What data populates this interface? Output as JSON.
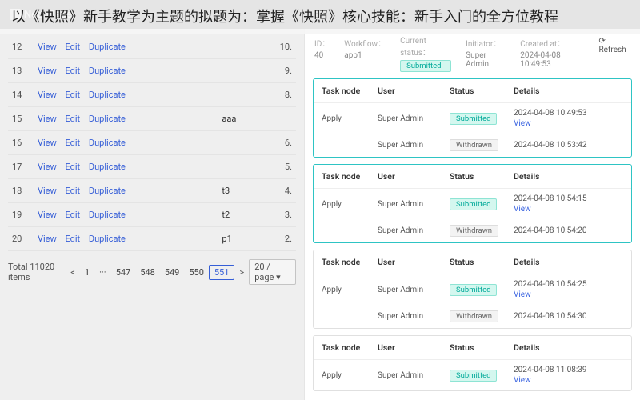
{
  "brand": "NocoBase",
  "overlay_title": "以《快照》新手教学为主题的拟题为：掌握《快照》核心技能：新手入门的全方位教程",
  "actions": {
    "view": "View",
    "edit": "Edit",
    "dup": "Duplicate"
  },
  "rows": [
    {
      "n": "12",
      "t": "",
      "r": "10."
    },
    {
      "n": "13",
      "t": "",
      "r": "9."
    },
    {
      "n": "14",
      "t": "",
      "r": "8."
    },
    {
      "n": "15",
      "t": "aaa",
      "r": ""
    },
    {
      "n": "16",
      "t": "",
      "r": "6."
    },
    {
      "n": "17",
      "t": "",
      "r": "5."
    },
    {
      "n": "18",
      "t": "t3",
      "r": "4."
    },
    {
      "n": "19",
      "t": "t2",
      "r": "3."
    },
    {
      "n": "20",
      "t": "p1",
      "r": "2."
    }
  ],
  "pager": {
    "total": "Total 11020 items",
    "pages": [
      "1",
      "···",
      "547",
      "548",
      "549",
      "550",
      "551"
    ],
    "active": "551",
    "size": "20 / page"
  },
  "meta": {
    "id_lbl": "ID：",
    "id": "40",
    "wf_lbl": "Workflow：",
    "wf": "app1",
    "st_lbl": "Current status：",
    "st": "Submitted",
    "in_lbl": "Initiator：",
    "in": "Super Admin",
    "cr_lbl": "Created at：",
    "cr": "2024-04-08 10:49:53",
    "refresh": "⟳ Refresh"
  },
  "hdr": {
    "node": "Task node",
    "user": "User",
    "status": "Status",
    "details": "Details"
  },
  "status": {
    "sub": "Submitted",
    "wd": "Withdrawn"
  },
  "vlink": "View",
  "apply": "Apply",
  "cards": [
    {
      "hl": true,
      "rows": [
        {
          "u": "Super Admin",
          "s": "sub",
          "d": "2024-04-08 10:49:53",
          "v": true
        },
        {
          "u": "Super Admin",
          "s": "wd",
          "d": "2024-04-08 10:53:42"
        }
      ]
    },
    {
      "hl": true,
      "rows": [
        {
          "u": "Super Admin",
          "s": "sub",
          "d": "2024-04-08 10:54:15",
          "v": true
        },
        {
          "u": "Super Admin",
          "s": "wd",
          "d": "2024-04-08 10:54:20"
        }
      ]
    },
    {
      "hl": false,
      "rows": [
        {
          "u": "Super Admin",
          "s": "sub",
          "d": "2024-04-08 10:54:25",
          "v": true
        },
        {
          "u": "Super Admin",
          "s": "wd",
          "d": "2024-04-08 10:54:30"
        }
      ]
    },
    {
      "hl": false,
      "rows": [
        {
          "u": "Super Admin",
          "s": "sub",
          "d": "2024-04-08 11:08:39",
          "v": true
        }
      ]
    }
  ]
}
